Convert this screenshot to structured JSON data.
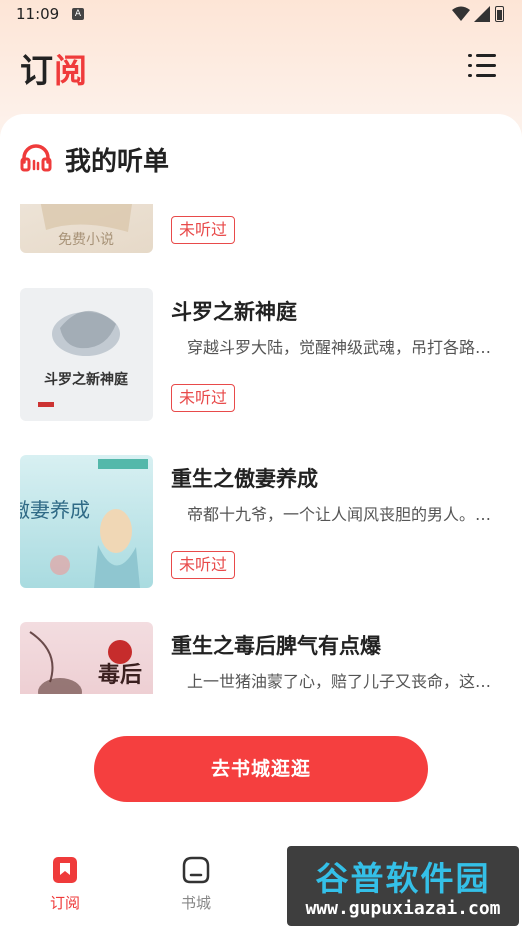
{
  "status_bar": {
    "time": "11:09",
    "notif_badge": "A"
  },
  "header": {
    "title_left": "订",
    "title_right": "阅",
    "accent": "#ef3b3b"
  },
  "list": {
    "title": "我的听单",
    "books": [
      {
        "title": "",
        "desc": "",
        "tag": "未听过",
        "cover_text": "免费小说"
      },
      {
        "title": "斗罗之新神庭",
        "desc": "穿越斗罗大陆，觉醒神级武魂，吊打各路…",
        "tag": "未听过",
        "cover_text": "斗罗之新神庭"
      },
      {
        "title": "重生之傲妻养成",
        "desc": "帝都十九爷，一个让人闻风丧胆的男人。…",
        "tag": "未听过",
        "cover_text": "傲妻养成"
      },
      {
        "title": "重生之毒后脾气有点爆",
        "desc": "上一世猪油蒙了心，赔了儿子又丧命，这…",
        "tag": "",
        "cover_text": "毒后"
      }
    ]
  },
  "cta": {
    "label": "去书城逛逛"
  },
  "bottom_nav": {
    "items": [
      {
        "label": "订阅",
        "icon": "bookmark-icon",
        "active": true
      },
      {
        "label": "书城",
        "icon": "home-icon",
        "active": false
      }
    ]
  },
  "watermark": {
    "title": "谷普软件园",
    "url": "www.gupuxiazai.com"
  }
}
